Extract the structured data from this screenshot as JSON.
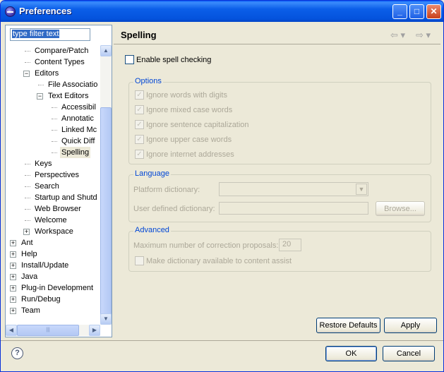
{
  "window": {
    "title": "Preferences"
  },
  "filter": {
    "value": "type filter text"
  },
  "tree": [
    {
      "label": "Compare/Patch",
      "indent": 2
    },
    {
      "label": "Content Types",
      "indent": 2
    },
    {
      "label": "Editors",
      "indent": 2,
      "expanded": true
    },
    {
      "label": "File Associatio",
      "indent": 3
    },
    {
      "label": "Text Editors",
      "indent": 3,
      "expanded": true
    },
    {
      "label": "Accessibil",
      "indent": 4
    },
    {
      "label": "Annotatic",
      "indent": 4
    },
    {
      "label": "Linked Mc",
      "indent": 4
    },
    {
      "label": "Quick Diff",
      "indent": 4
    },
    {
      "label": "Spelling",
      "indent": 4,
      "selected": true
    },
    {
      "label": "Keys",
      "indent": 2
    },
    {
      "label": "Perspectives",
      "indent": 2
    },
    {
      "label": "Search",
      "indent": 2
    },
    {
      "label": "Startup and Shutd",
      "indent": 2
    },
    {
      "label": "Web Browser",
      "indent": 2
    },
    {
      "label": "Welcome",
      "indent": 2
    },
    {
      "label": "Workspace",
      "indent": 2,
      "collapsed": true
    },
    {
      "label": "Ant",
      "indent": 1,
      "collapsed": true
    },
    {
      "label": "Help",
      "indent": 1,
      "collapsed": true
    },
    {
      "label": "Install/Update",
      "indent": 1,
      "collapsed": true
    },
    {
      "label": "Java",
      "indent": 1,
      "collapsed": true
    },
    {
      "label": "Plug-in Development",
      "indent": 1,
      "collapsed": true
    },
    {
      "label": "Run/Debug",
      "indent": 1,
      "collapsed": true
    },
    {
      "label": "Team",
      "indent": 1,
      "collapsed": true
    }
  ],
  "page": {
    "title": "Spelling",
    "enable_spell": {
      "label": "Enable spell checking",
      "checked": false
    }
  },
  "options": {
    "title": "Options",
    "items": [
      "Ignore words with digits",
      "Ignore mixed case words",
      "Ignore sentence capitalization",
      "Ignore upper case words",
      "Ignore internet addresses"
    ]
  },
  "language": {
    "title": "Language",
    "platform_label": "Platform dictionary:",
    "user_label": "User defined dictionary:",
    "browse_label": "Browse..."
  },
  "advanced": {
    "title": "Advanced",
    "max_label": "Maximum number of correction proposals:",
    "max_value": "20",
    "content_assist_label": "Make dictionary available to content assist"
  },
  "buttons": {
    "restore_defaults": "Restore Defaults",
    "apply": "Apply",
    "ok": "OK",
    "cancel": "Cancel"
  }
}
